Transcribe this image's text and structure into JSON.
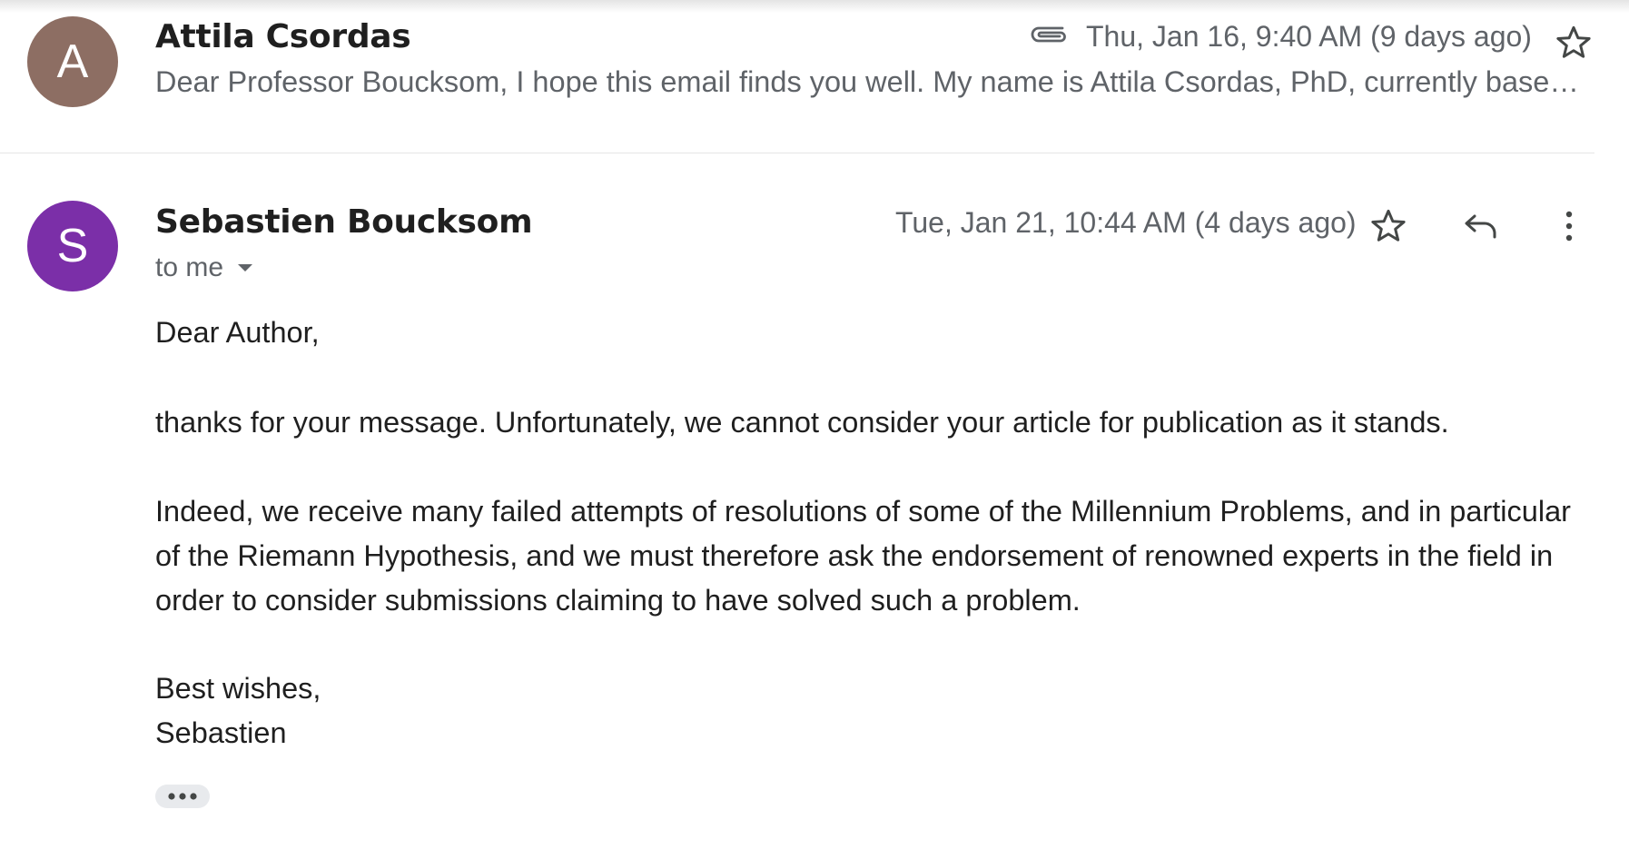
{
  "thread": [
    {
      "avatar_letter": "A",
      "avatar_color": "#8d6e63",
      "sender": "Attila Csordas",
      "date": "Thu, Jan 16, 9:40 AM (9 days ago)",
      "has_attachment": true,
      "snippet": "Dear Professor Boucksom, I hope this email finds you well. My name is Attila Csordas, PhD, currently based in..."
    },
    {
      "avatar_letter": "S",
      "avatar_color": "#7b2fa8",
      "sender": "Sebastien Boucksom",
      "date": "Tue, Jan 21, 10:44 AM (4 days ago)",
      "recipient_label": "to me",
      "body": {
        "greeting": "Dear Author,",
        "para1": "thanks for your message. Unfortunately, we cannot consider your article for publication as it stands.",
        "para2_lines": [
          "Indeed, we receive many failed attempts of resolutions of some of the Millennium Problems, and in particular",
          "of the Riemann Hypothesis, and we must therefore ask the endorsement of renowned experts in the field in",
          "order to consider submissions claiming to have solved such a problem."
        ],
        "closing": "Best wishes,",
        "signature": "Sebastien"
      }
    }
  ],
  "icons": {
    "attachment": "paperclip-icon",
    "star": "star-icon",
    "reply": "reply-icon",
    "more": "more-vertical-icon",
    "dropdown": "dropdown-arrow-icon",
    "trimmed": "show-trimmed-content-icon"
  }
}
